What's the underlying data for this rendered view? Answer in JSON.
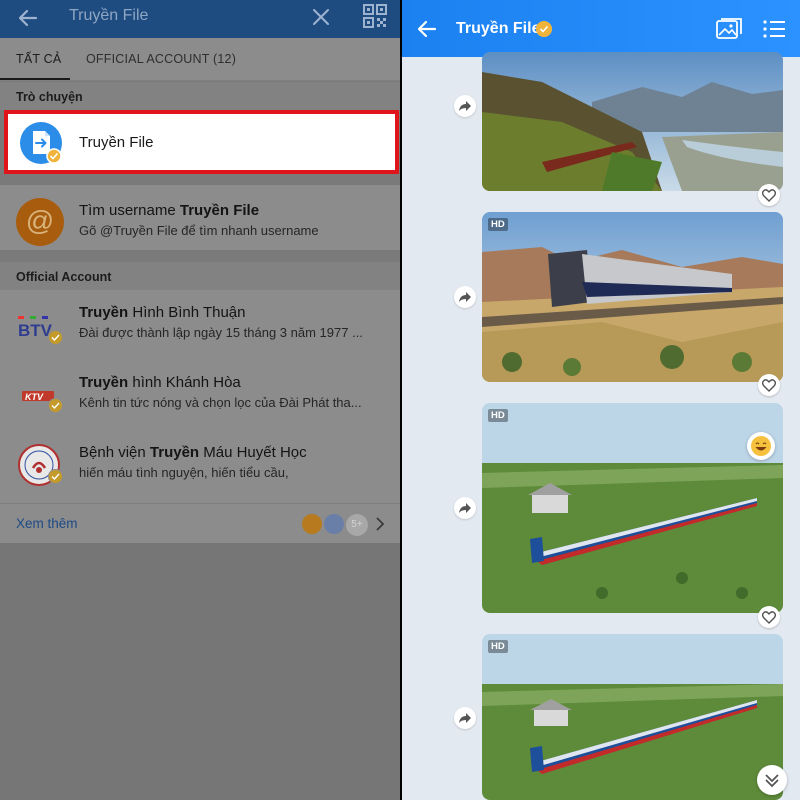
{
  "left": {
    "search_query": "Truyền File",
    "tabs": [
      {
        "label": "TẤT CẢ"
      },
      {
        "label": "OFFICIAL ACCOUNT (12)"
      }
    ],
    "sections": {
      "chats": "Trò chuyện",
      "official": "Official Account"
    },
    "chat_result": {
      "name": "Truyền File"
    },
    "username_search": {
      "prefix": "Tìm username ",
      "bold": "Truyền File",
      "hint": "Gõ @Truyền File để tìm nhanh username"
    },
    "official_accounts": [
      {
        "bold": "Truyền",
        "rest": " Hình Bình Thuận",
        "desc": "Đài được thành lập ngày 15 tháng 3 năm 1977 ...",
        "logo_text": "BTV"
      },
      {
        "bold": "Truyền",
        "rest": " hình Khánh Hòa",
        "desc": "Kênh tin tức nóng và chọn lọc của Đài Phát tha...",
        "logo_text": "KTV"
      },
      {
        "pre": "Bệnh viện ",
        "bold": "Truyền",
        "rest": " Máu Huyết Học",
        "desc": "hiến máu tình nguyện, hiến tiểu cầu,"
      }
    ],
    "see_more": "Xem thêm",
    "more_count": "5+"
  },
  "right": {
    "title": "Truyền File",
    "images": [
      {
        "hd": ""
      },
      {
        "hd": "HD"
      },
      {
        "hd": "HD"
      },
      {
        "hd": "HD"
      }
    ]
  },
  "colors": {
    "left_header": "#1f4c80",
    "right_header": "#2b92ff",
    "highlight_border": "#e0141b",
    "link": "#1d4a86"
  }
}
